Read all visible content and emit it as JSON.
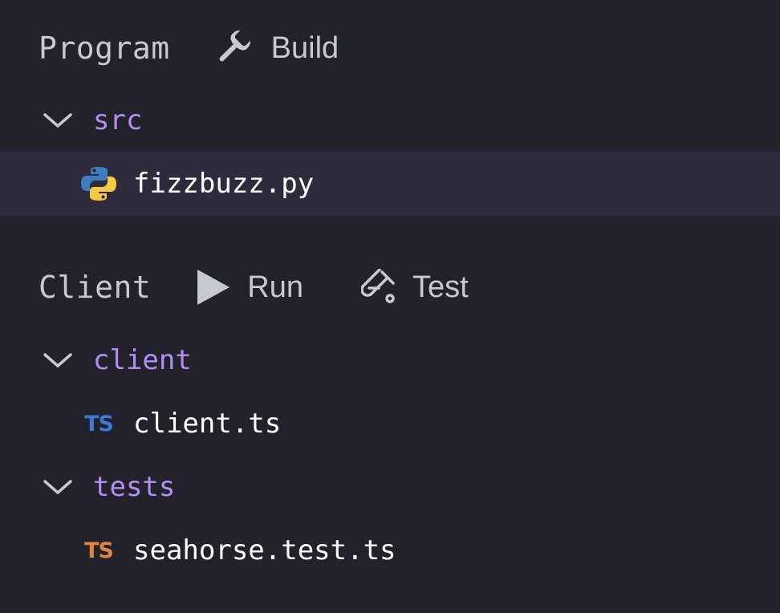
{
  "sections": [
    {
      "title": "Program",
      "actions": [
        {
          "label": "Build",
          "icon": "wrench-icon"
        }
      ],
      "folders": [
        {
          "name": "src",
          "files": [
            {
              "name": "fizzbuzz.py",
              "icon": "python-icon",
              "selected": true
            }
          ]
        }
      ]
    },
    {
      "title": "Client",
      "actions": [
        {
          "label": "Run",
          "icon": "play-icon"
        },
        {
          "label": "Test",
          "icon": "test-tube-icon"
        }
      ],
      "folders": [
        {
          "name": "client",
          "files": [
            {
              "name": "client.ts",
              "icon": "ts-icon",
              "badge": "TS",
              "badge_color": "#3b7bd4"
            }
          ]
        },
        {
          "name": "tests",
          "files": [
            {
              "name": "seahorse.test.ts",
              "icon": "ts-icon",
              "badge": "TS",
              "badge_color": "#e0843f"
            }
          ]
        }
      ]
    }
  ],
  "colors": {
    "background": "#22222b",
    "selected_row": "#2d2b3c",
    "folder": "#b48ef5",
    "header_text": "#c7c9d1",
    "file_text": "#ffffff"
  }
}
